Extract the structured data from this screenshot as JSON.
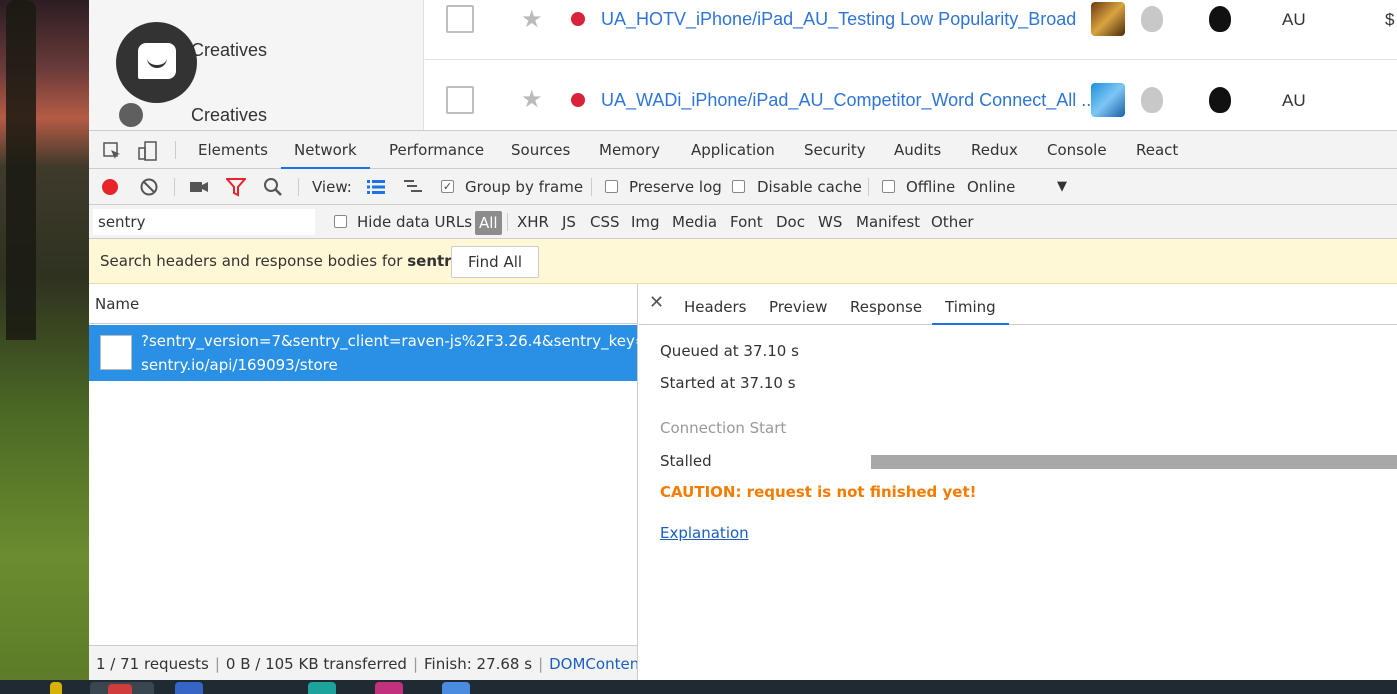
{
  "app": {
    "sidebar_labels": [
      "Creatives",
      "Creatives"
    ],
    "rows": [
      {
        "name": "UA_HOTV_iPhone/iPad_AU_Testing Low Popularity_Broad",
        "country": "AU",
        "currency": "$"
      },
      {
        "name": "UA_WADi_iPhone/iPad_AU_Competitor_Word Connect_All ...",
        "country": "AU",
        "currency": ""
      }
    ]
  },
  "devtools": {
    "tabs": [
      "Elements",
      "Network",
      "Performance",
      "Sources",
      "Memory",
      "Application",
      "Security",
      "Audits",
      "Redux",
      "Console",
      "React"
    ],
    "active_tab": "Network",
    "toolbar": {
      "view_label": "View:",
      "group_by_frame": "Group by frame",
      "preserve_log": "Preserve log",
      "disable_cache": "Disable cache",
      "offline": "Offline",
      "throttle": "Online"
    },
    "filter": {
      "value": "sentry",
      "hide_data_urls": "Hide data URLs",
      "types": [
        "All",
        "XHR",
        "JS",
        "CSS",
        "Img",
        "Media",
        "Font",
        "Doc",
        "WS",
        "Manifest",
        "Other"
      ]
    },
    "search_banner": {
      "prefix": "Search headers and response bodies for",
      "term": "sentry",
      "button": "Find All"
    },
    "requests": {
      "column": "Name",
      "row": {
        "line1": "?sentry_version=7&sentry_client=raven-js%2F3.26.4&sentry_key=...",
        "line2": "sentry.io/api/169093/store"
      },
      "status": {
        "requests": "1 / 71 requests",
        "transferred": "0 B / 105 KB transferred",
        "finish": "Finish: 27.68 s",
        "dom": "DOMConten..."
      }
    },
    "detail": {
      "tabs": [
        "Headers",
        "Preview",
        "Response",
        "Timing"
      ],
      "active_tab": "Timing",
      "queued": "Queued at 37.10 s",
      "started": "Started at 37.10 s",
      "section": "Connection Start",
      "stalled": "Stalled",
      "caution": "CAUTION: request is not finished yet!",
      "explanation": "Explanation"
    },
    "colors": {
      "accent": "#1a73e8",
      "selected_row": "#2a90e5",
      "caution": "#f57c00",
      "record": "#e8242a"
    }
  }
}
